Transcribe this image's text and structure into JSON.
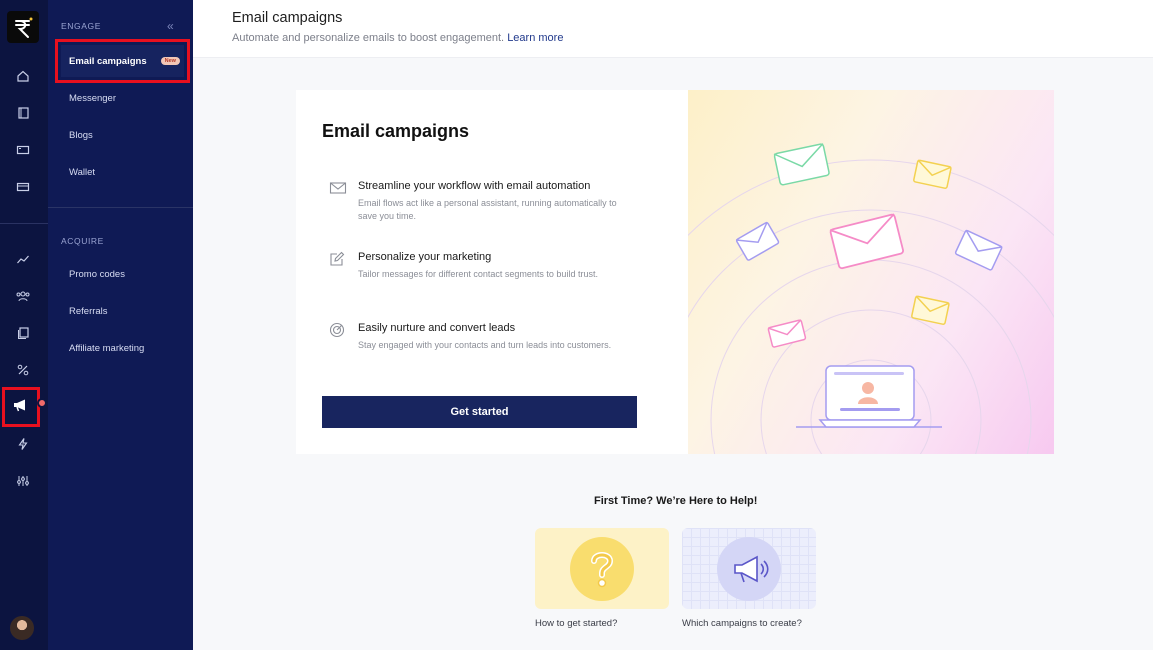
{
  "rail": {
    "icons": [
      "logo-icon",
      "home-icon",
      "book-icon",
      "ticket-icon",
      "card-icon",
      "chart-icon",
      "users-icon",
      "copy-icon",
      "percent-icon",
      "megaphone-icon",
      "bolt-icon",
      "sliders-icon"
    ],
    "active": "megaphone-icon",
    "notification_dot_color": "#f06a6a"
  },
  "nav": {
    "engage_label": "ENGAGE",
    "engage_items": [
      {
        "label": "Email campaigns",
        "badge": "New",
        "active": true
      },
      {
        "label": "Messenger"
      },
      {
        "label": "Blogs"
      },
      {
        "label": "Wallet"
      }
    ],
    "acquire_label": "ACQUIRE",
    "acquire_items": [
      {
        "label": "Promo codes"
      },
      {
        "label": "Referrals"
      },
      {
        "label": "Affiliate marketing"
      }
    ]
  },
  "header": {
    "title": "Email campaigns",
    "subtitle": "Automate and personalize emails to boost engagement.",
    "learn_more": "Learn more"
  },
  "card": {
    "title": "Email campaigns",
    "features": [
      {
        "icon": "email-icon",
        "title": "Streamline your workflow with email automation",
        "desc": "Email flows act like a personal assistant, running automatically to save you time."
      },
      {
        "icon": "edit-icon",
        "title": "Personalize your marketing",
        "desc": "Tailor messages for different contact segments to build trust."
      },
      {
        "icon": "target-icon",
        "title": "Easily nurture and convert leads",
        "desc": "Stay engaged with your contacts and turn leads into customers."
      }
    ],
    "cta": "Get started"
  },
  "help": {
    "title": "First Time? We’re Here to Help!",
    "tiles": [
      {
        "label": "How to get started?",
        "icon": "question-icon"
      },
      {
        "label": "Which campaigns to create?",
        "icon": "megaphone-icon"
      }
    ]
  },
  "colors": {
    "rail_bg": "#0c1440",
    "nav_bg": "#0f1a55",
    "primary": "#18255f",
    "highlight_outline": "#e8101f",
    "link": "#223a8c"
  }
}
